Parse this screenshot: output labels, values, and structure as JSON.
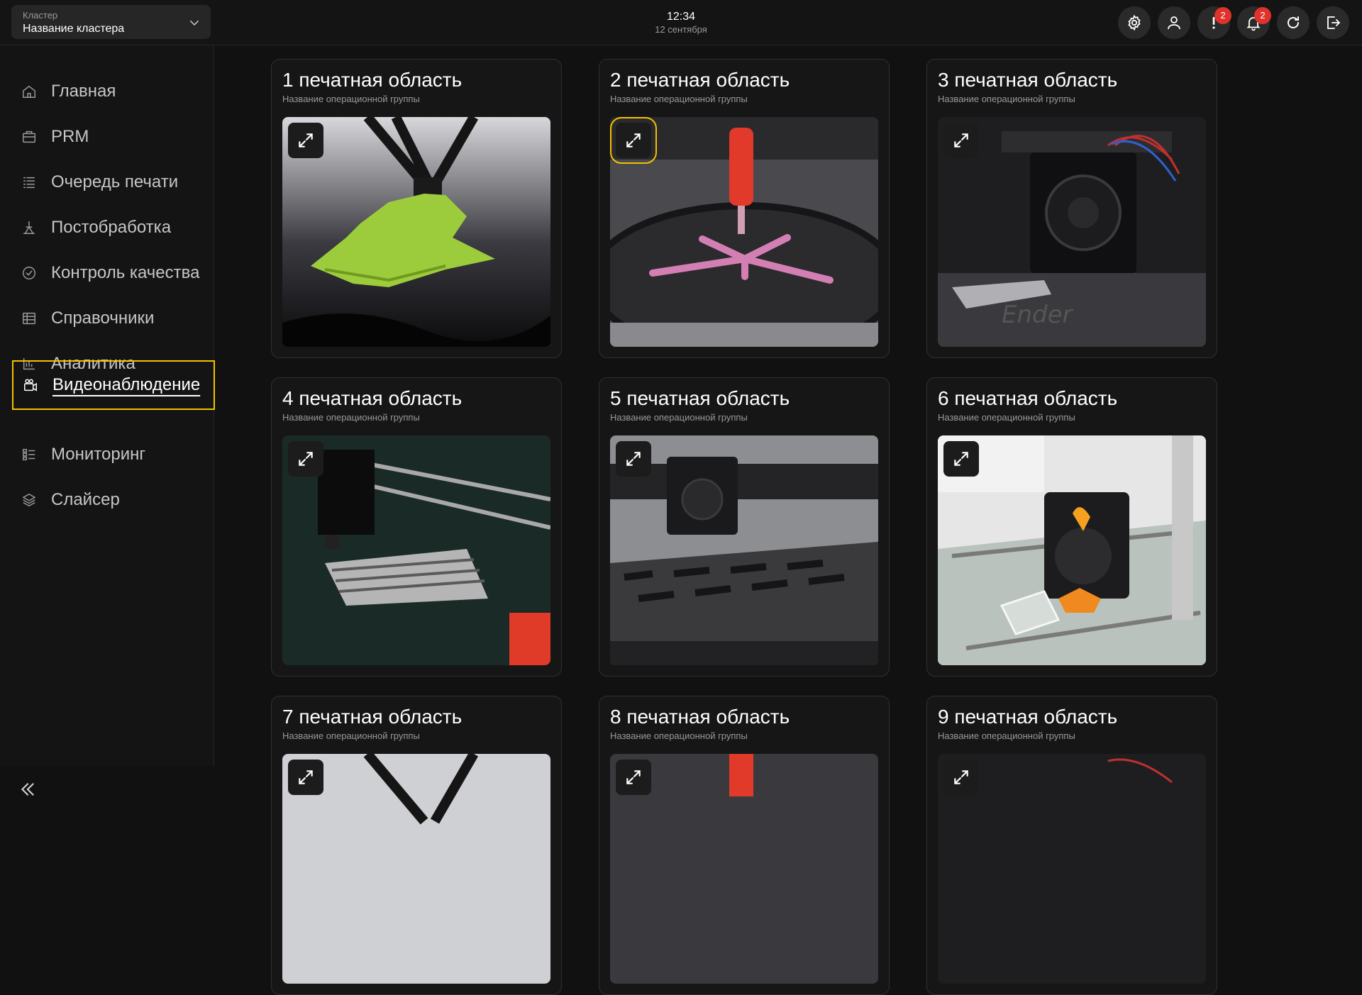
{
  "header": {
    "cluster_label": "Кластер",
    "cluster_name": "Название кластера",
    "time": "12:34",
    "date": "12 сентября",
    "alerts_count": "2",
    "notifications_count": "2"
  },
  "sidebar": {
    "items": [
      {
        "label": "Главная",
        "icon": "home-icon"
      },
      {
        "label": "PRM",
        "icon": "briefcase-icon"
      },
      {
        "label": "Очередь печати",
        "icon": "list-icon"
      },
      {
        "label": "Постобработка",
        "icon": "tools-icon"
      },
      {
        "label": "Контроль качества",
        "icon": "check-circle-icon"
      },
      {
        "label": "Справочники",
        "icon": "table-icon"
      },
      {
        "label": "Аналитика",
        "icon": "bar-chart-icon"
      },
      {
        "label": "Видеонаблюдение",
        "icon": "camera-icon"
      },
      {
        "label": "Мониторинг",
        "icon": "grid-list-icon"
      },
      {
        "label": "Слайсер",
        "icon": "layers-icon"
      }
    ],
    "active": "Видеонаблюдение"
  },
  "cards": [
    {
      "title": "1 печатная область",
      "subtitle": "Название операционной группы"
    },
    {
      "title": "2 печатная область",
      "subtitle": "Название операционной группы"
    },
    {
      "title": "3 печатная область",
      "subtitle": "Название операционной группы"
    },
    {
      "title": "4 печатная область",
      "subtitle": "Название операционной группы"
    },
    {
      "title": "5 печатная область",
      "subtitle": "Название операционной группы"
    },
    {
      "title": "6 печатная область",
      "subtitle": "Название операционной группы"
    },
    {
      "title": "7 печатная область",
      "subtitle": "Название операционной группы"
    },
    {
      "title": "8 печатная область",
      "subtitle": "Название операционной группы"
    },
    {
      "title": "9 печатная область",
      "subtitle": "Название операционной группы"
    }
  ],
  "colors": {
    "accent": "#f2c100",
    "badge": "#e0322d",
    "background": "#111111"
  }
}
